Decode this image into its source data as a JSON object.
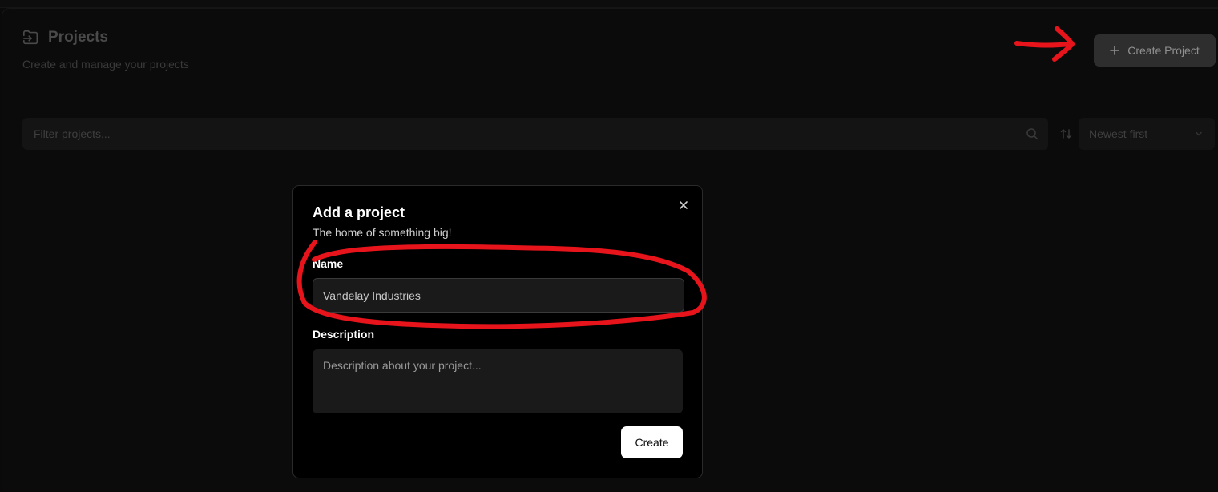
{
  "header": {
    "title": "Projects",
    "subtitle": "Create and manage your projects",
    "create_button_label": "Create Project"
  },
  "filter": {
    "placeholder": "Filter projects...",
    "value": ""
  },
  "sort": {
    "selected": "Newest first"
  },
  "modal": {
    "title": "Add a project",
    "description": "The home of something big!",
    "name_label": "Name",
    "name_value": "Vandelay Industries",
    "description_label": "Description",
    "description_placeholder": "Description about your project...",
    "create_button_label": "Create"
  },
  "icons": {
    "folder": "folder-import-icon",
    "plus": "plus-icon",
    "search": "search-icon",
    "sort": "sort-arrows-icon",
    "chevron": "chevron-down-icon",
    "close": "close-icon"
  },
  "colors": {
    "background": "#0b0b0b",
    "modal_background": "#000000",
    "primary_button": "#ffffff",
    "annotation": "#e8141b"
  }
}
